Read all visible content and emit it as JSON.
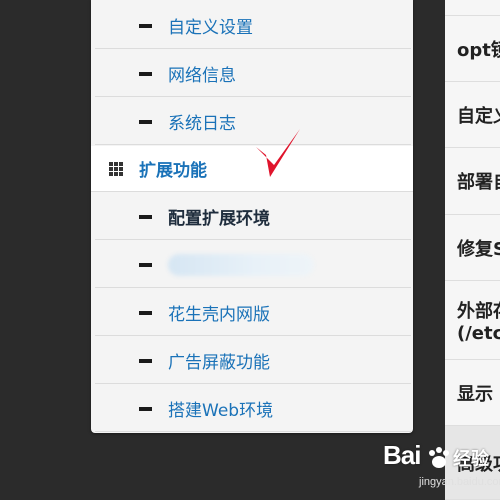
{
  "menu": {
    "items_top": [
      {
        "label": "自定义设置"
      },
      {
        "label": "网络信息"
      },
      {
        "label": "系统日志"
      }
    ],
    "section": {
      "label": "扩展功能",
      "icon": "grid-icon"
    },
    "items_sub": [
      {
        "label": "配置扩展环境",
        "active": true
      },
      {
        "label": "",
        "blurred": true
      },
      {
        "label": "花生壳内网版"
      },
      {
        "label": "广告屏蔽功能"
      },
      {
        "label": "搭建Web环境"
      }
    ]
  },
  "right_panel": {
    "rows": [
      {
        "label": "opt镜"
      },
      {
        "label": "自定义"
      },
      {
        "label": "部署自"
      },
      {
        "label": "修复S"
      },
      {
        "label": "外部存",
        "label2": "(/etc/"
      },
      {
        "label": "显示"
      },
      {
        "label": "高级功"
      }
    ]
  },
  "watermark": {
    "brand": "Bai",
    "suffix": "经验",
    "url": "jingyan.baidu.com"
  },
  "colors": {
    "link": "#1a72b8",
    "active": "#1f2d3d",
    "annotation": "#e0142c",
    "background": "#2b2b2b"
  }
}
